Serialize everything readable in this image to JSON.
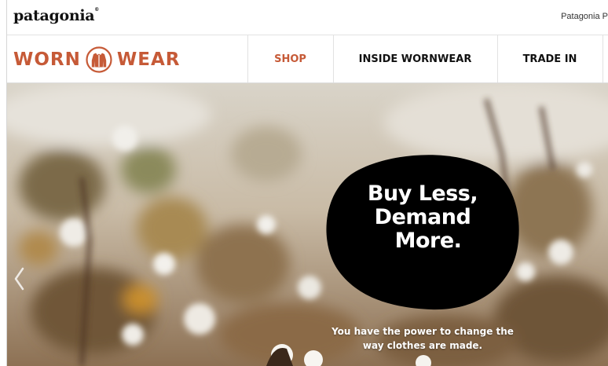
{
  "topbar": {
    "brand": "patagonia",
    "link": "Patagonia P"
  },
  "nav": {
    "logo_left": "WORN",
    "logo_right": "WEAR",
    "items": [
      {
        "label": "SHOP",
        "active": true
      },
      {
        "label": "INSIDE WORNWEAR",
        "active": false
      },
      {
        "label": "TRADE IN",
        "active": false
      }
    ]
  },
  "hero": {
    "headline": [
      "Buy Less,",
      "Demand",
      "More."
    ],
    "caption": [
      "You have the power to change the",
      "way clothes are made."
    ]
  },
  "colors": {
    "accent": "#c65a37",
    "blob": "#000000"
  },
  "icons": {
    "logo_emblem": "jacket-icon",
    "carousel_prev": "chevron-left-icon"
  }
}
